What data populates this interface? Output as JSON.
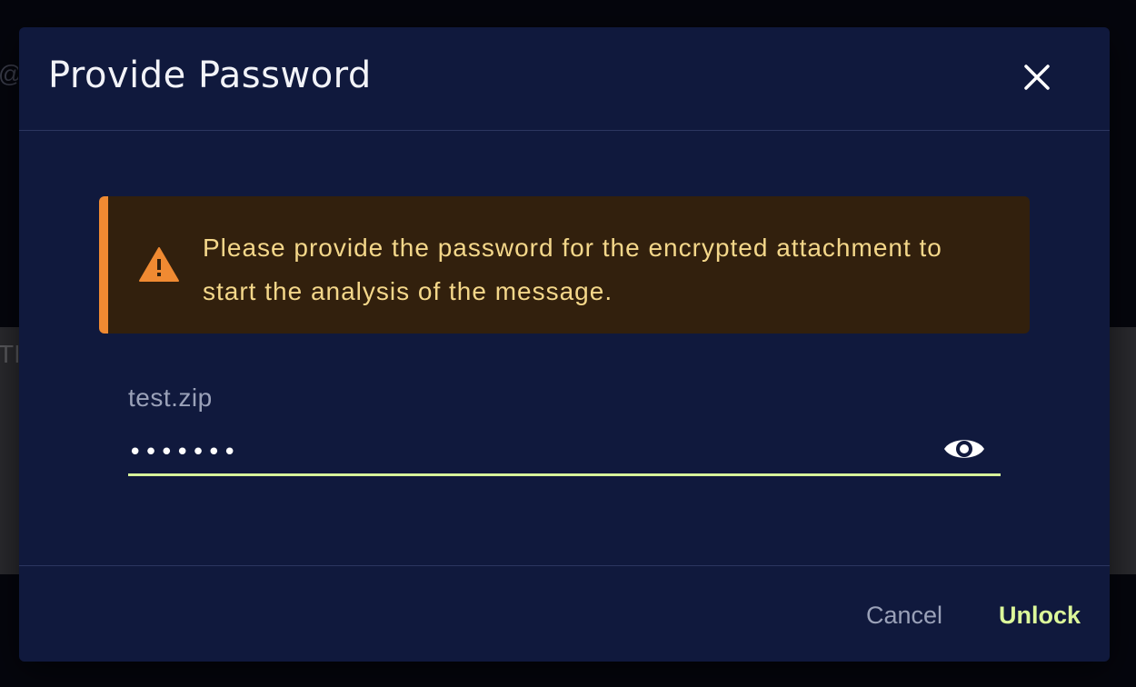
{
  "background": {
    "fragment_top": "@t",
    "fragment_band": "TI"
  },
  "dialog": {
    "title": "Provide Password",
    "close_icon": "close-icon",
    "alert": {
      "icon": "warning-triangle-icon",
      "message": "Please provide the password for the encrypted attachment to start the analysis of the message.",
      "accent_color": "#f08a32"
    },
    "field": {
      "label": "test.zip",
      "value": "•••••••",
      "toggle_icon": "eye-icon"
    },
    "footer": {
      "cancel_label": "Cancel",
      "unlock_label": "Unlock"
    },
    "colors": {
      "surface": "#10193d",
      "accent": "#d7f29a",
      "alert_text": "#f4d78a"
    }
  }
}
